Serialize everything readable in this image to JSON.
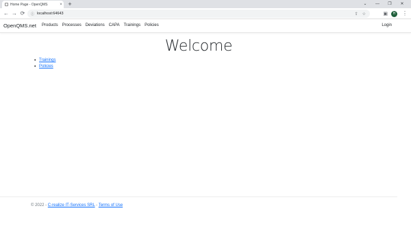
{
  "browser": {
    "tab_title": "Home Page - OpenQMS",
    "tab_close": "×",
    "new_tab": "+",
    "window_controls": [
      "⌄",
      "—",
      "❐",
      "✕"
    ],
    "nav": {
      "back": "←",
      "forward": "→",
      "reload": "⟳"
    },
    "address": {
      "lock": "ⓘ",
      "url": "localhost:64643"
    },
    "omni_icons": [
      "share-icon",
      "star-icon"
    ],
    "profile_initial": "H",
    "menu": "⋮"
  },
  "site": {
    "brand": "OpenQMS.net",
    "nav_items": [
      "Products",
      "Processes",
      "Deviations",
      "CAPA",
      "Trainings",
      "Policies"
    ],
    "login": "Login"
  },
  "main": {
    "heading": "Welcome",
    "links": [
      "Trainings",
      "Policies"
    ]
  },
  "footer": {
    "prefix": "© 2022 - ",
    "company": "C-realize IT-Services SRL",
    "separator": " - ",
    "terms": "Terms of Use"
  },
  "colors": {
    "link": "#0d6efd",
    "profile_bg": "#1e5e3a"
  }
}
